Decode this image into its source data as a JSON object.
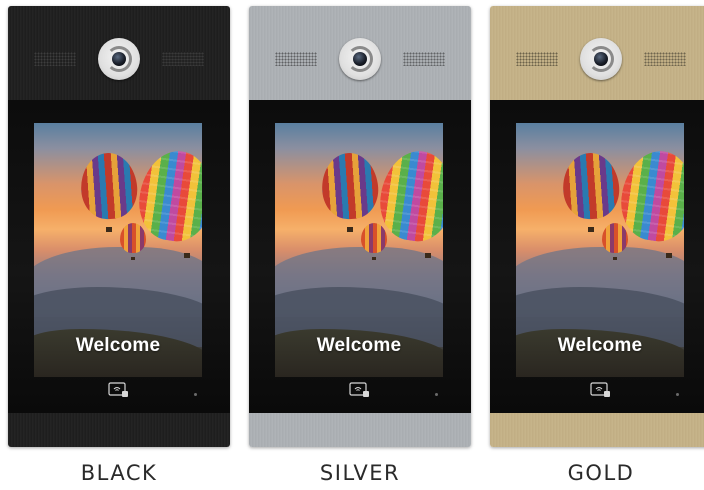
{
  "panels": [
    {
      "id": "black",
      "welcome": "Welcome",
      "label": "BLACK",
      "color": "#1d1d1d",
      "brand": ""
    },
    {
      "id": "silver",
      "welcome": "Welcome",
      "label": "SILVER",
      "color": "#b0b4b8",
      "brand": ""
    },
    {
      "id": "gold",
      "welcome": "Welcome",
      "label": "GOLD",
      "color": "#c6b487",
      "brand": ""
    }
  ],
  "icons": {
    "camera": "camera-icon",
    "speaker": "speaker-grille-icon",
    "card_reader": "card-reader-icon"
  }
}
